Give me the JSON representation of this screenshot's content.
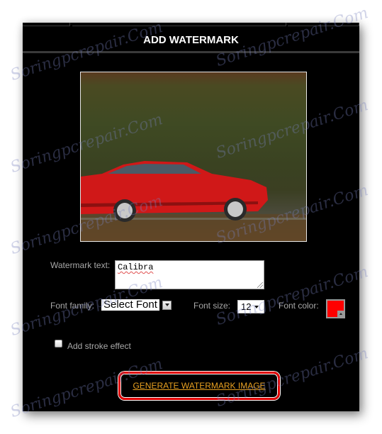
{
  "panel": {
    "title": "ADD WATERMARK"
  },
  "preview": {
    "description": "red coupe car driving on road, motion-blurred green background",
    "car_color": "#d01818"
  },
  "form": {
    "watermark_text_label": "Watermark text:",
    "watermark_text_value": "Calibra",
    "font_family_label": "Font family:",
    "font_family_value": "Select Font",
    "font_size_label": "Font size:",
    "font_size_value": "12",
    "font_color_label": "Font color:",
    "font_color_value": "#ff0000",
    "stroke_label": "Add stroke effect",
    "stroke_checked": false
  },
  "actions": {
    "generate_label": "GENERATE WATERMARK IMAGE",
    "highlight_color": "#e00000",
    "link_color": "#e8a020"
  },
  "overlay_watermark": "Soringpcrepair.Com"
}
